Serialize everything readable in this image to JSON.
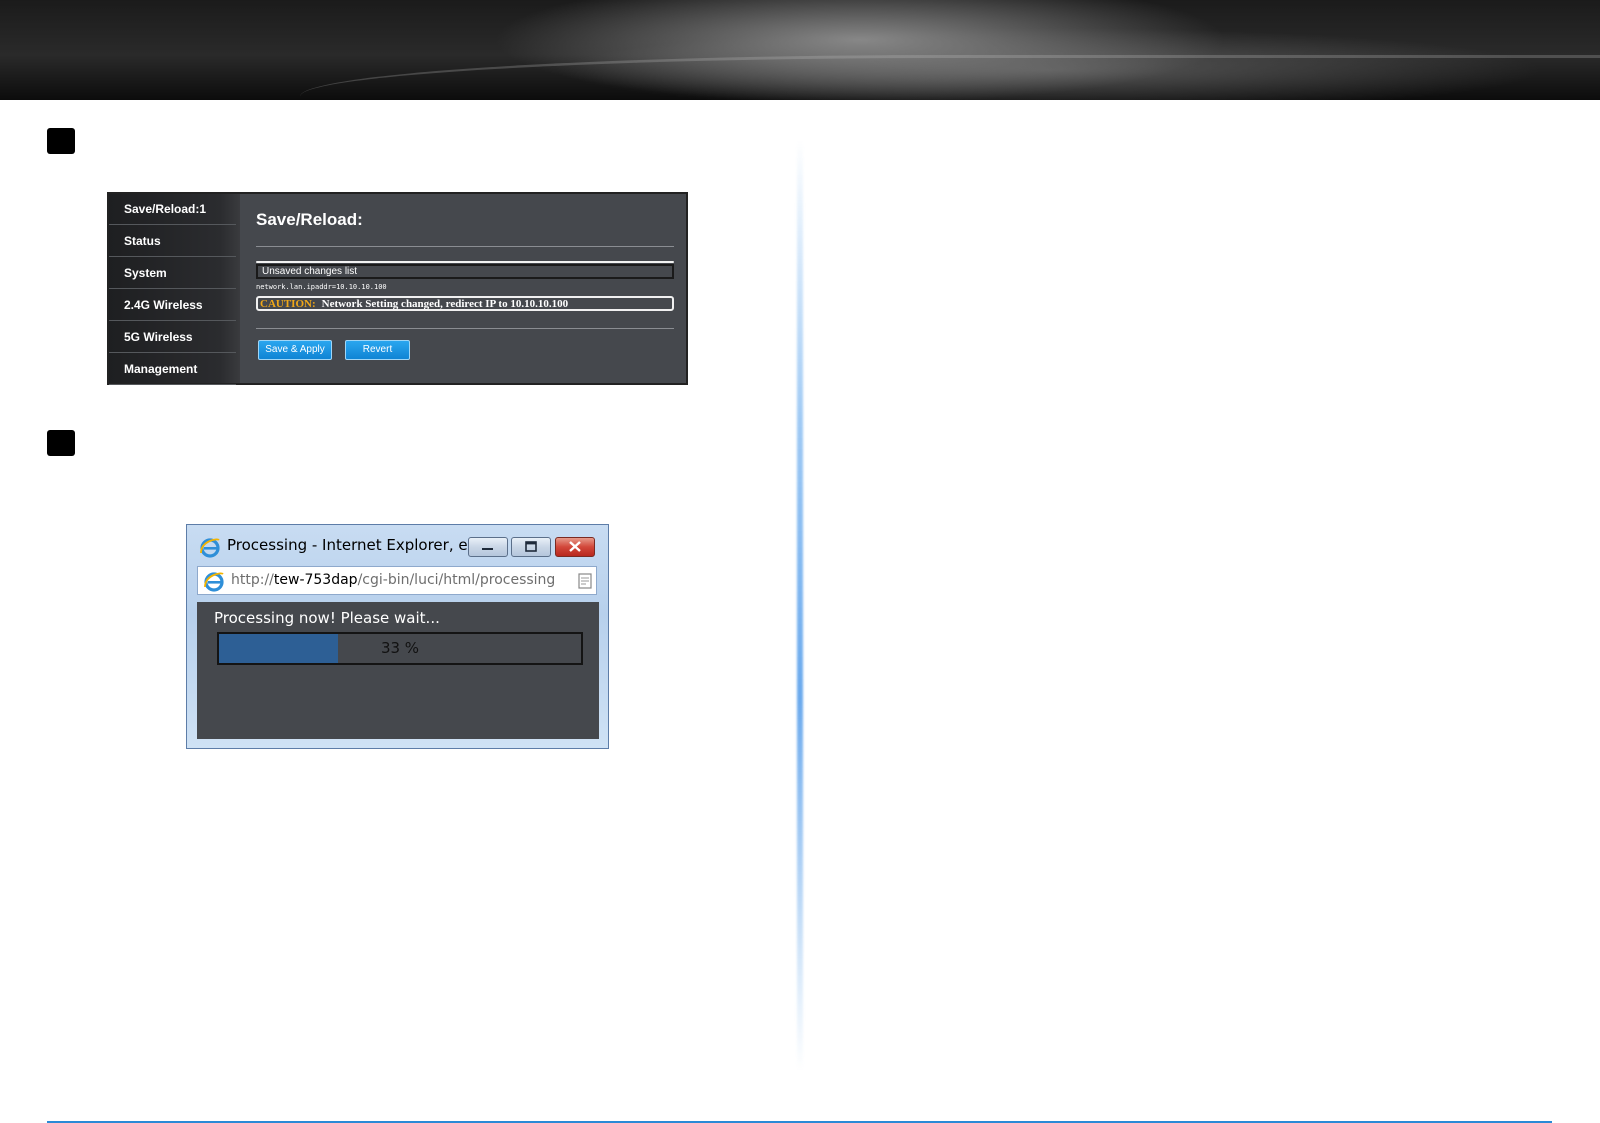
{
  "router_ui": {
    "title": "Save/Reload:",
    "menu": [
      {
        "label": "Save/Reload:1"
      },
      {
        "label": "Status"
      },
      {
        "label": "System"
      },
      {
        "label": "2.4G Wireless"
      },
      {
        "label": "5G Wireless"
      },
      {
        "label": "Management"
      }
    ],
    "changes_list_label": "Unsaved changes list",
    "change_entry": "network.lan.ipaddr=10.10.10.100",
    "caution_label": "CAUTION:",
    "caution_text": "Network Setting changed, redirect IP to  10.10.10.100",
    "save_apply_label": "Save & Apply",
    "revert_label": "Revert"
  },
  "ie_window": {
    "title": "Processing - Internet Explorer, e...",
    "url_prefix": "http://",
    "url_host": "tew-753dap",
    "url_path": "/cgi-bin/luci/html/processing",
    "processing_text": "Processing now! Please wait...",
    "progress_percent": 33,
    "progress_label": "33 %"
  },
  "colors": {
    "accent_blue": "#2a8ad6",
    "caution": "#f0a818",
    "progress_fill": "#2d5f95"
  }
}
